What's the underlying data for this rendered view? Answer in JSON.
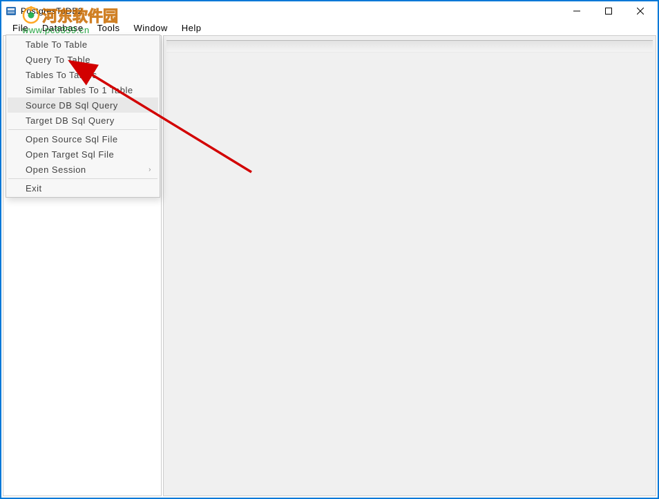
{
  "window": {
    "title": "PostgresToDB2"
  },
  "menubar": {
    "items": [
      "File",
      "Database",
      "Tools",
      "Window",
      "Help"
    ]
  },
  "file_menu": {
    "items": [
      {
        "label": "Table To Table",
        "highlighted": false,
        "separator_after": false,
        "has_submenu": false
      },
      {
        "label": "Query To Table",
        "highlighted": false,
        "separator_after": false,
        "has_submenu": false
      },
      {
        "label": "Tables To Tables",
        "highlighted": false,
        "separator_after": false,
        "has_submenu": false
      },
      {
        "label": "Similar Tables To 1 Table",
        "highlighted": false,
        "separator_after": false,
        "has_submenu": false
      },
      {
        "label": "Source DB Sql Query",
        "highlighted": true,
        "separator_after": false,
        "has_submenu": false
      },
      {
        "label": "Target DB Sql Query",
        "highlighted": false,
        "separator_after": true,
        "has_submenu": false
      },
      {
        "label": "Open Source Sql File",
        "highlighted": false,
        "separator_after": false,
        "has_submenu": false
      },
      {
        "label": "Open Target Sql File",
        "highlighted": false,
        "separator_after": false,
        "has_submenu": false
      },
      {
        "label": "Open Session",
        "highlighted": false,
        "separator_after": true,
        "has_submenu": true
      },
      {
        "label": "Exit",
        "highlighted": false,
        "separator_after": false,
        "has_submenu": false
      }
    ]
  },
  "watermark": {
    "text": "河东软件园",
    "url": "www.pc0359.cn"
  }
}
